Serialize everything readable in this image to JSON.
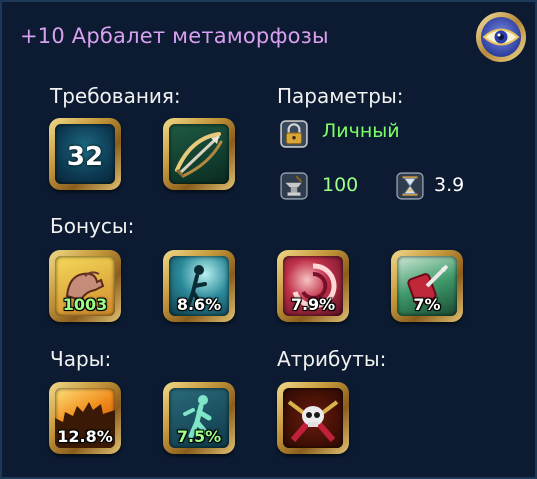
{
  "item": {
    "title": "+10 Арбалет метаморфозы"
  },
  "sections": {
    "requirements": "Требования:",
    "parameters": "Параметры:",
    "bonuses": "Бонусы:",
    "enchants": "Чары:",
    "attributes": "Атрибуты:"
  },
  "requirements": {
    "level": "32",
    "weapon_icon": "crossbow-icon"
  },
  "parameters": {
    "binding": "Личный",
    "binding_icon": "lock-icon",
    "durability": "100",
    "durability_icon": "anvil-icon",
    "speed": "3.9",
    "speed_icon": "hourglass-icon"
  },
  "bonuses": [
    {
      "icon": "strength-arm-icon",
      "value": "1003",
      "highlight": "green"
    },
    {
      "icon": "dodge-figure-icon",
      "value": "8.6%"
    },
    {
      "icon": "crit-swirl-icon",
      "value": "7.9%"
    },
    {
      "icon": "crit-damage-icon",
      "value": "7%"
    }
  ],
  "enchants": [
    {
      "icon": "fire-saw-icon",
      "value": "12.8%"
    },
    {
      "icon": "speed-figure-icon",
      "value": "7.5%",
      "highlight": "green"
    }
  ],
  "attributes": [
    {
      "icon": "skull-weapon-icon"
    }
  ],
  "colors": {
    "title": "#d9a0f0",
    "binding": "#7cff66",
    "durability": "#9bff8a",
    "frame_gold": "#c79a3e",
    "background": "#0c1b31"
  }
}
